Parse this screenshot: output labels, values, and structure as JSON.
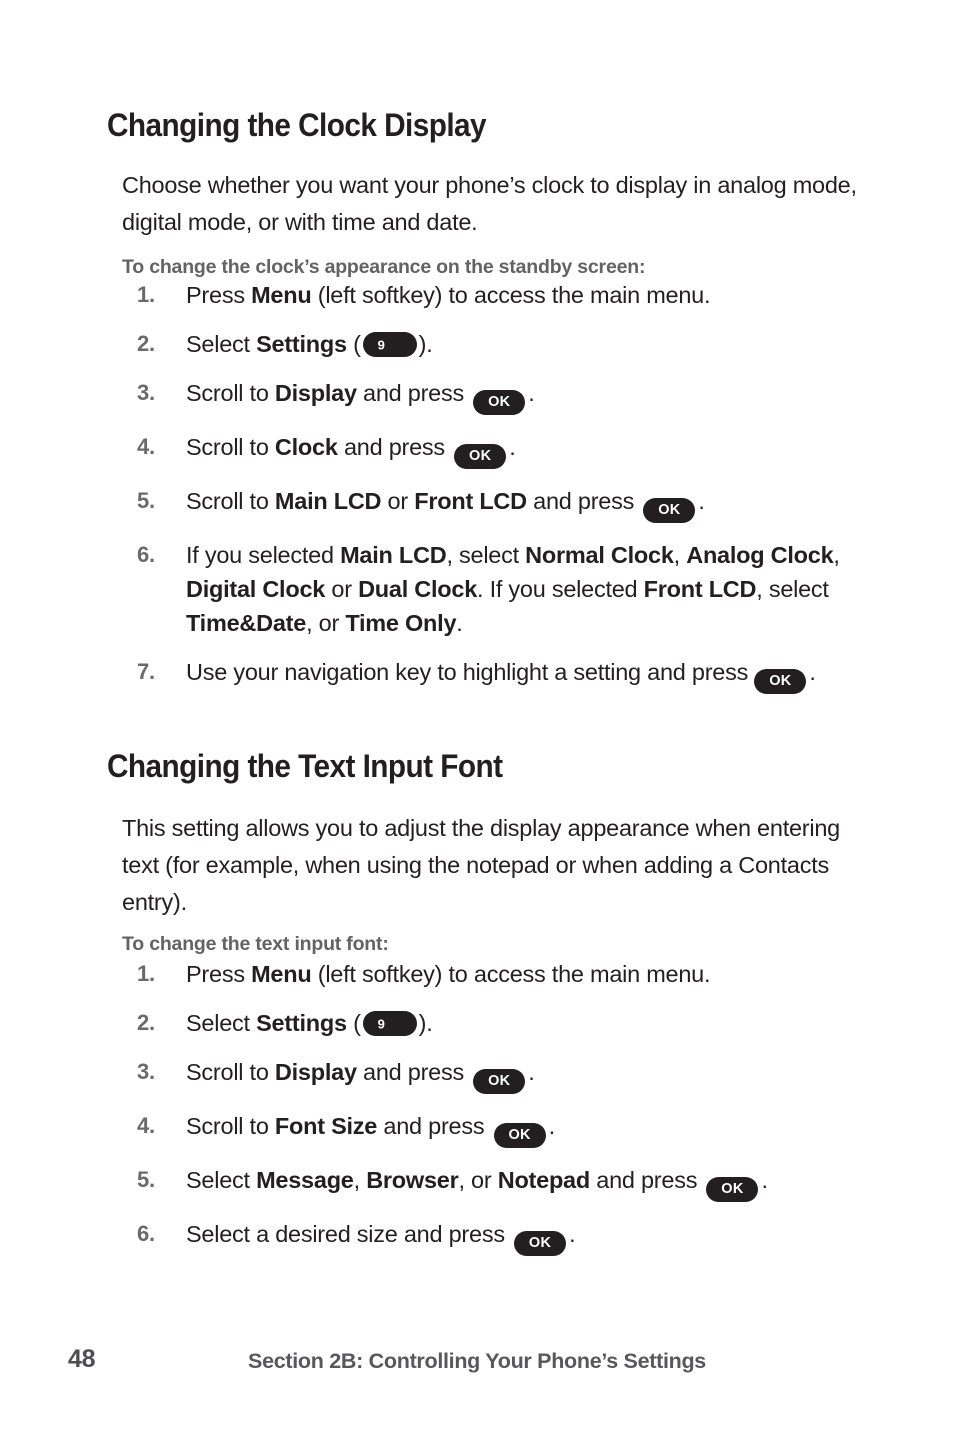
{
  "page": {
    "number": "48",
    "footer_section": "Section 2B: Controlling Your Phone’s Settings"
  },
  "sections": [
    {
      "heading": "Changing the Clock Display",
      "paragraph": "Choose whether you want your phone’s clock to display in analog mode, digital mode, or with time and date.",
      "subheading": "To change the clock’s appearance on the standby screen:",
      "steps": [
        {
          "num": "1.",
          "text_1": "Press ",
          "bold_1": "Menu",
          "text_2": " (left softkey) to access the main menu."
        },
        {
          "num": "2.",
          "text_1": "Select ",
          "bold_1": "Settings",
          "text_2": " (",
          "key": "9",
          "text_3": ")."
        },
        {
          "num": "3.",
          "text_1": "Scroll to ",
          "bold_1": "Display",
          "text_2": " and press ",
          "key": "OK",
          "text_3": "."
        },
        {
          "num": "4.",
          "text_1": "Scroll to ",
          "bold_1": "Clock",
          "text_2": " and press ",
          "key": "OK",
          "text_3": "."
        },
        {
          "num": "5.",
          "text_1": "Scroll to ",
          "bold_1": "Main LCD",
          "text_2": " or ",
          "bold_2": "Front LCD",
          "text_3": " and press ",
          "key": "OK",
          "text_4": "."
        },
        {
          "num": "6.",
          "text_1": "If you selected ",
          "bold_1": "Main LCD",
          "text_2": ", select ",
          "bold_2": "Normal Clock",
          "text_3": ", ",
          "bold_3": "Analog Clock",
          "text_4": ", ",
          "bold_4": "Digital Clock",
          "text_5": " or ",
          "bold_5": "Dual Clock",
          "text_6": ". If you selected ",
          "bold_6": "Front LCD",
          "text_7": ", select ",
          "bold_7": "Time&Date",
          "text_8": ", or ",
          "bold_8": "Time Only",
          "text_9": "."
        },
        {
          "num": "7.",
          "text_1": "Use your navigation key to highlight a setting and press ",
          "key": "OK",
          "text_2": "."
        }
      ]
    },
    {
      "heading": "Changing the Text Input Font",
      "paragraph": "This setting allows you to adjust the display appearance when entering text (for example, when using the notepad or when adding a Contacts entry).",
      "subheading": "To change the text input font:",
      "steps": [
        {
          "num": "1.",
          "text_1": "Press ",
          "bold_1": "Menu",
          "text_2": " (left softkey) to access the main menu."
        },
        {
          "num": "2.",
          "text_1": "Select ",
          "bold_1": "Settings",
          "text_2": " (",
          "key": "9",
          "text_3": ")."
        },
        {
          "num": "3.",
          "text_1": "Scroll to ",
          "bold_1": "Display",
          "text_2": " and press ",
          "key": "OK",
          "text_3": "."
        },
        {
          "num": "4.",
          "text_1": "Scroll to ",
          "bold_1": "Font Size",
          "text_2": " and press ",
          "key": "OK",
          "text_3": "."
        },
        {
          "num": "5.",
          "text_1": "Select ",
          "bold_1": "Message",
          "text_2": ", ",
          "bold_2": "Browser",
          "text_3": ", or ",
          "bold_3": "Notepad",
          "text_4": " and press ",
          "key": "OK",
          "text_5": "."
        },
        {
          "num": "6.",
          "text_1": "Select a desired size and press ",
          "key": "OK",
          "text_2": "."
        }
      ]
    }
  ],
  "keys": {
    "ok_label": "OK",
    "nine_label": "9"
  },
  "colors": {
    "text": "#231f20",
    "gray_heading": "#636363",
    "gray_number": "#6a6a6a",
    "key_fill": "#231f20",
    "key_text": "#ffffff",
    "background": "#ffffff"
  }
}
